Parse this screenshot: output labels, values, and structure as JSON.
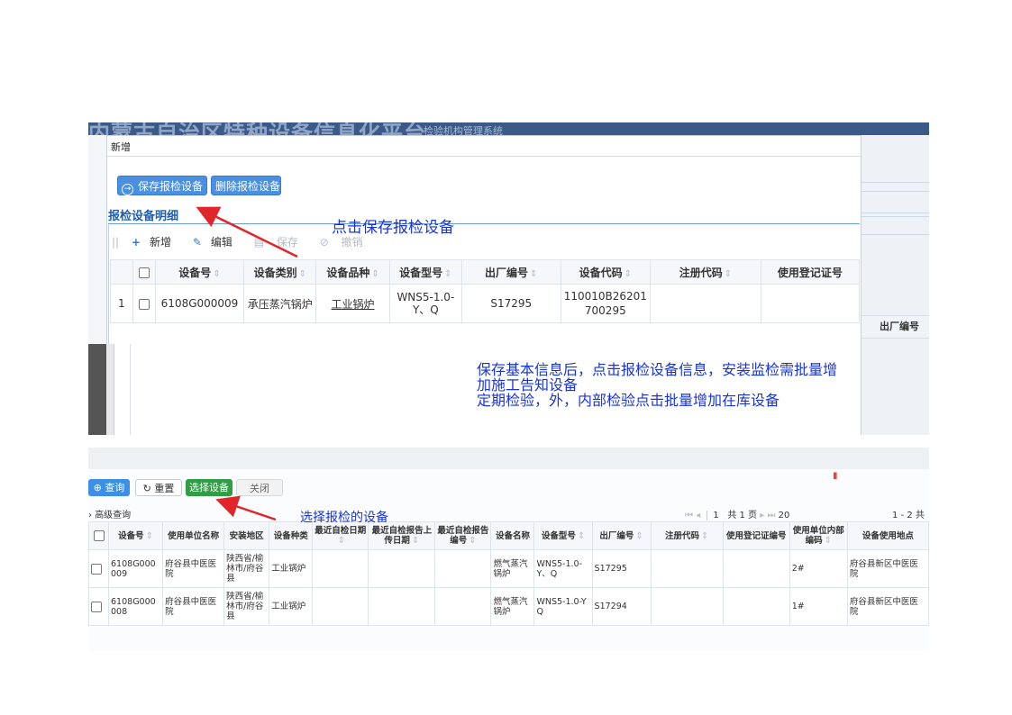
{
  "top_app": {
    "banner_title": "内蒙古自治区特种设备信息化平台",
    "banner_subtitle": "检验机构管理系统",
    "dialog_title": "新增",
    "buttons": {
      "save_inspection": "保存报检设备",
      "delete_inspection": "删除报检设备"
    },
    "section_title": "报检设备明细",
    "toolbar": {
      "add": "新增",
      "edit": "编辑",
      "save": "保存",
      "cancel": "撤销"
    },
    "right_column_label": "出厂编号",
    "columns": [
      "设备号",
      "设备类别",
      "设备品种",
      "设备型号",
      "出厂编号",
      "设备代码",
      "注册代码",
      "使用登记证号"
    ],
    "rows": [
      {
        "index": "1",
        "device_no": "6108G000009",
        "category": "承压蒸汽锅炉",
        "variety": "工业锅炉",
        "model": "WNS5-1.0-Y、Q",
        "factory_no": "S17295",
        "device_code": "110010B26201700295",
        "reg_code": "",
        "use_cert": ""
      }
    ]
  },
  "callouts": {
    "click_save": "点击保存报检设备",
    "instruction_lines": [
      "保存基本信息后，点击报检设备信息，安装监检需批量增",
      "加施工告知设备",
      "定期检验，外，内部检验点击批量增加在库设备"
    ],
    "select_devices": "选择报检的设备"
  },
  "bottom_app": {
    "buttons": {
      "query": "查询",
      "reset": "重置",
      "select": "选择设备",
      "close": "关闭"
    },
    "advanced_search": "高级查询",
    "pager": {
      "page": "1",
      "total_pages": "共 1 页",
      "page_size": "20",
      "range": "1 - 2 共"
    },
    "columns": [
      "设备号",
      "使用单位名称",
      "安装地区",
      "设备种类",
      "最近自检日期",
      "最近自检报告上传日期",
      "最近自检报告编号",
      "设备名称",
      "设备型号",
      "出厂编号",
      "注册代码",
      "使用登记证编号",
      "使用单位内部编码",
      "设备使用地点"
    ],
    "rows": [
      {
        "device_no": "6108G000009",
        "unit": "府谷县中医医院",
        "region": "陕西省/榆林市/府谷县",
        "kind": "工业锅炉",
        "self_date": "",
        "upload_date": "",
        "report_no": "",
        "name": "燃气蒸汽锅炉",
        "model": "WNS5-1.0-Y、Q",
        "factory_no": "S17295",
        "reg_code": "",
        "use_cert": "",
        "inner_code": "2#",
        "location": "府谷县新区中医医院"
      },
      {
        "device_no": "6108G000008",
        "unit": "府谷县中医医院",
        "region": "陕西省/榆林市/府谷县",
        "kind": "工业锅炉",
        "self_date": "",
        "upload_date": "",
        "report_no": "",
        "name": "燃气蒸汽锅炉",
        "model": "WNS5-1.0-YQ",
        "factory_no": "S17294",
        "reg_code": "",
        "use_cert": "",
        "inner_code": "1#",
        "location": "府谷县新区中医医院"
      }
    ]
  },
  "colors": {
    "primary_blue": "#4b8fe0",
    "callout_blue": "#1a35d6",
    "arrow_red": "#e0262a",
    "select_green": "#2f9e44"
  }
}
